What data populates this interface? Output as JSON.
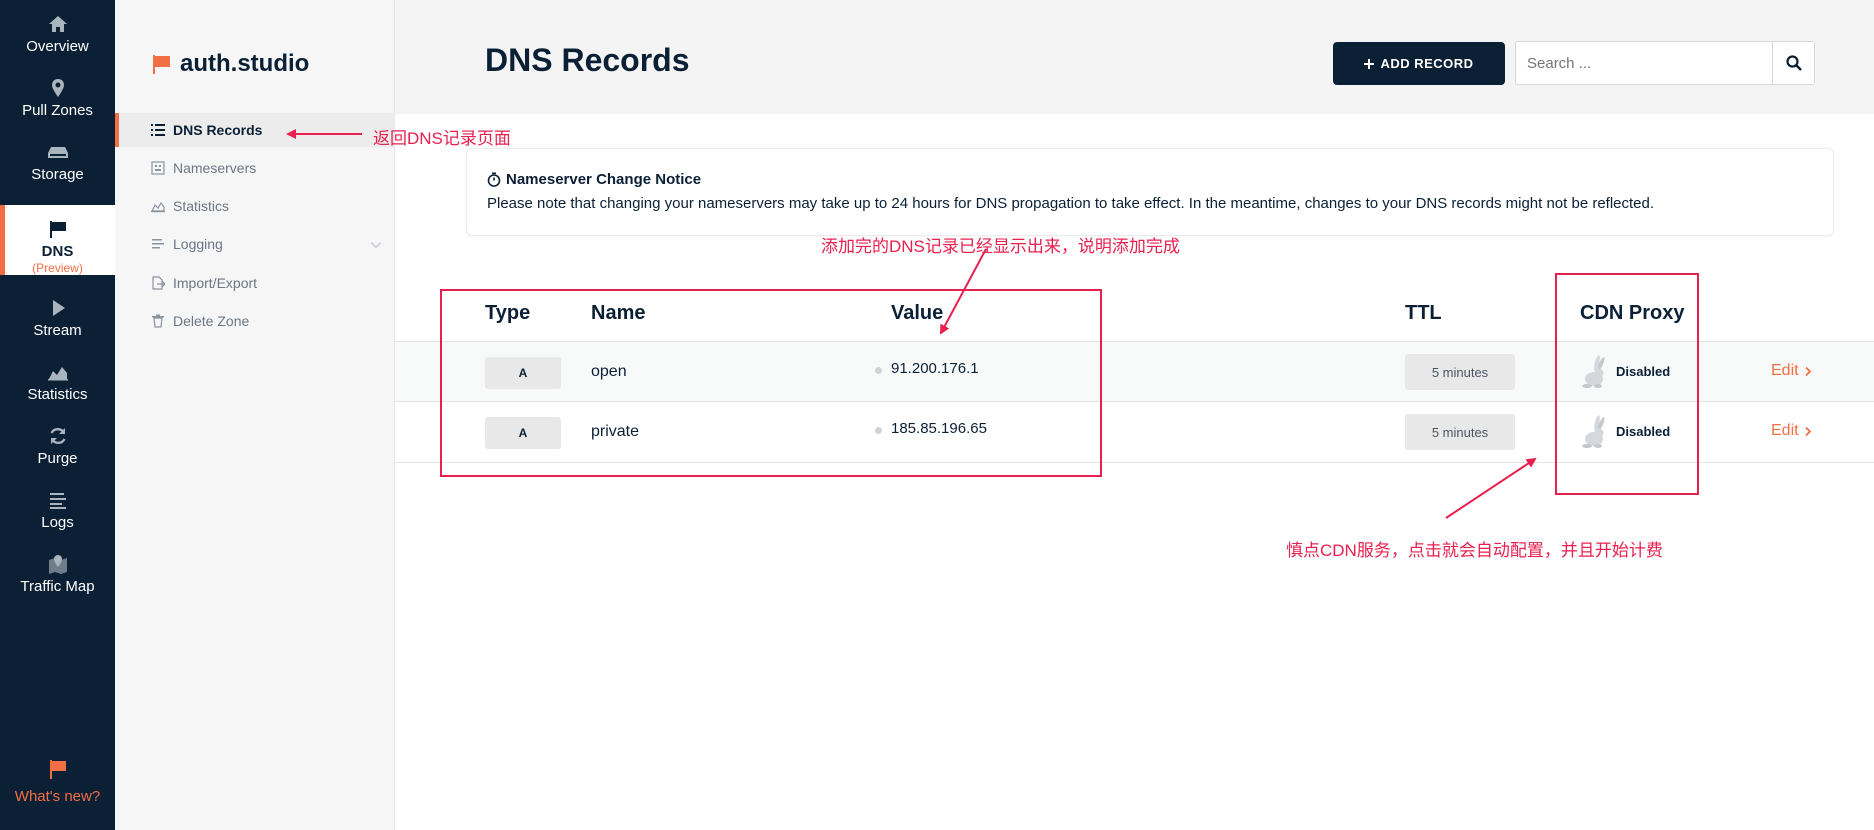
{
  "nav": {
    "items": [
      {
        "label": "Overview"
      },
      {
        "label": "Pull Zones"
      },
      {
        "label": "Storage"
      },
      {
        "label": "DNS",
        "sub": "(Preview)"
      },
      {
        "label": "Stream"
      },
      {
        "label": "Statistics"
      },
      {
        "label": "Purge"
      },
      {
        "label": "Logs"
      },
      {
        "label": "Traffic Map"
      }
    ],
    "whats_new": "What's new?"
  },
  "sidebar": {
    "brand": "auth.studio",
    "items": [
      {
        "label": "DNS Records"
      },
      {
        "label": "Nameservers"
      },
      {
        "label": "Statistics"
      },
      {
        "label": "Logging"
      },
      {
        "label": "Import/Export"
      },
      {
        "label": "Delete Zone"
      }
    ]
  },
  "header": {
    "title": "DNS Records",
    "add_label": "ADD RECORD",
    "search_placeholder": "Search ..."
  },
  "notice": {
    "title": "Nameserver Change Notice",
    "body": "Please note that changing your nameservers may take up to 24 hours for DNS propagation to take effect. In the meantime, changes to your DNS records might not be reflected."
  },
  "table": {
    "columns": {
      "type": "Type",
      "name": "Name",
      "value": "Value",
      "ttl": "TTL",
      "proxy": "CDN Proxy"
    },
    "rows": [
      {
        "type": "A",
        "name": "open",
        "value": "91.200.176.1",
        "ttl": "5 minutes",
        "proxy": "Disabled",
        "edit": "Edit"
      },
      {
        "type": "A",
        "name": "private",
        "value": "185.85.196.65",
        "ttl": "5 minutes",
        "proxy": "Disabled",
        "edit": "Edit"
      }
    ]
  },
  "annotations": {
    "back_note": "返回DNS记录页面",
    "added_note": "添加完的DNS记录已经显示出来，说明添加完成",
    "cdn_note": "慎点CDN服务，点击就会自动配置，并且开始计费"
  },
  "colors": {
    "navy": "#0b1f35",
    "accent": "#f26e44",
    "annotation": "#e8204f"
  }
}
